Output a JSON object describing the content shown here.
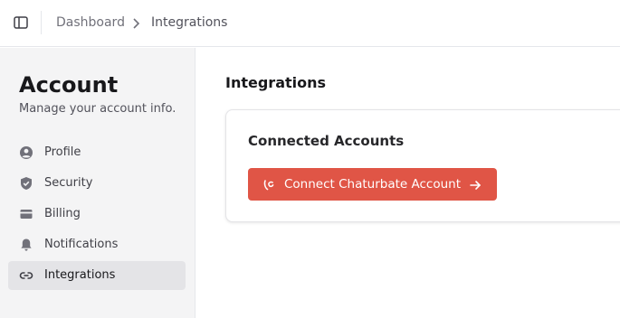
{
  "header": {
    "breadcrumb": [
      "Dashboard",
      "Integrations"
    ]
  },
  "sidebar": {
    "title": "Account",
    "subtitle": "Manage your account info.",
    "items": [
      {
        "label": "Profile",
        "icon": "user-circle-icon",
        "active": false
      },
      {
        "label": "Security",
        "icon": "shield-check-icon",
        "active": false
      },
      {
        "label": "Billing",
        "icon": "credit-card-icon",
        "active": false
      },
      {
        "label": "Notifications",
        "icon": "bell-icon",
        "active": false
      },
      {
        "label": "Integrations",
        "icon": "link-icon",
        "active": true
      }
    ]
  },
  "main": {
    "title": "Integrations",
    "card": {
      "title": "Connected Accounts",
      "button_label": "Connect Chaturbate Account"
    }
  },
  "colors": {
    "accent": "#e05546",
    "sidebar_bg": "#f4f4f5",
    "active_item_bg": "#e4e4e7"
  }
}
